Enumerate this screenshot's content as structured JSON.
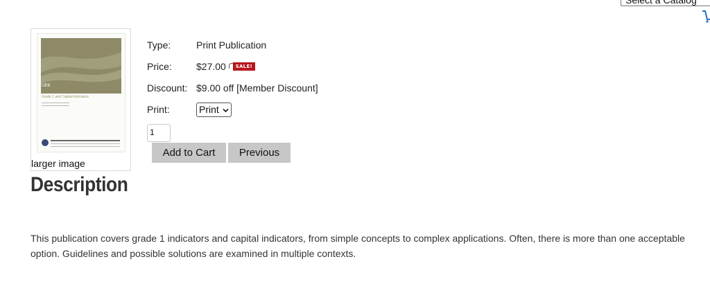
{
  "catalog": {
    "select_value": "Select a Catalog"
  },
  "cart": {
    "icon": "cart-icon"
  },
  "product": {
    "cover": {
      "code": "UEB",
      "title": "Grade 1 and Capital Indicators"
    },
    "larger_image_link": "larger image",
    "details": [
      {
        "label": "Type:",
        "value": "Print Publication"
      },
      {
        "label": "Price:",
        "value": "$27.00"
      },
      {
        "label": "Discount:",
        "value": "$9.00 off [Member Discount]"
      },
      {
        "label": "Print:",
        "value": "Print"
      }
    ],
    "sale_badge": "SALE!",
    "quantity": "1",
    "add_to_cart_label": "Add to Cart",
    "previous_label": "Previous"
  },
  "description": {
    "heading": "Description",
    "text": "This publication covers grade 1 indicators and capital indicators, from simple concepts to complex applications. Often, there is more than one acceptable option. Guidelines and possible solutions are examined in multiple contexts."
  },
  "colors": {
    "sale_red": "#b7151b",
    "button_gray": "#c7c7c7",
    "cover_olive": "#8e8a68"
  }
}
